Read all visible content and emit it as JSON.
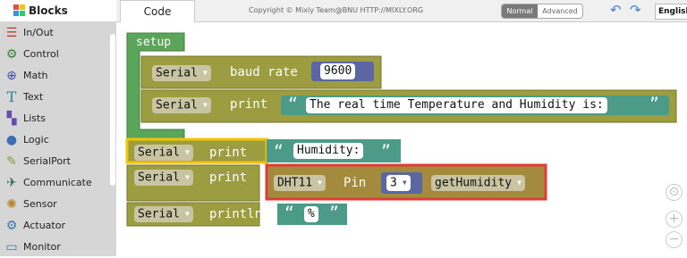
{
  "app": {
    "blocks_label": "Blocks",
    "tab_code": "Code",
    "copyright": "Copyright © Mixly Team@BNU HTTP://MIXLY.ORG",
    "mode_normal": "Normal",
    "mode_advanced": "Advanced",
    "language": "English"
  },
  "sidebar": {
    "items": [
      {
        "label": "In/Out",
        "icon": "in-out-icon",
        "color": "#c0392b"
      },
      {
        "label": "Control",
        "icon": "control-icon",
        "color": "#3a7d3a"
      },
      {
        "label": "Math",
        "icon": "math-icon",
        "color": "#3b4bb5"
      },
      {
        "label": "Text",
        "icon": "text-icon",
        "color": "#2a7f9a"
      },
      {
        "label": "Lists",
        "icon": "lists-icon",
        "color": "#6a4ab0"
      },
      {
        "label": "Logic",
        "icon": "logic-icon",
        "color": "#3a6fb5"
      },
      {
        "label": "SerialPort",
        "icon": "serialport-icon",
        "color": "#7aa33a"
      },
      {
        "label": "Communicate",
        "icon": "communicate-icon",
        "color": "#2c6e5c"
      },
      {
        "label": "Sensor",
        "icon": "sensor-icon",
        "color": "#b5872a"
      },
      {
        "label": "Actuator",
        "icon": "actuator-icon",
        "color": "#3a75b0"
      },
      {
        "label": "Monitor",
        "icon": "monitor-icon",
        "color": "#4a6fb0"
      }
    ]
  },
  "workspace": {
    "setup_label": "setup",
    "serial": "Serial",
    "baud_rate": "baud rate",
    "baud_value": "9600",
    "print": "print",
    "println": "println",
    "text1": "The real time Temperature and Humidity is:",
    "text2": "Humidity:",
    "text3": "%",
    "dht": "DHT11",
    "pin": "Pin",
    "pin_value": "3",
    "get_humidity": "getHumidity",
    "open_quote": "“",
    "close_quote": "”"
  },
  "colors": {
    "setup_green": "#5ba55b",
    "serial_olive": "#9c9c40",
    "text_teal": "#4c9b88",
    "sensor_olive": "#a38a3c",
    "math_blue": "#5b67a5",
    "highlight": "#e53935",
    "selected": "#f4c400"
  }
}
